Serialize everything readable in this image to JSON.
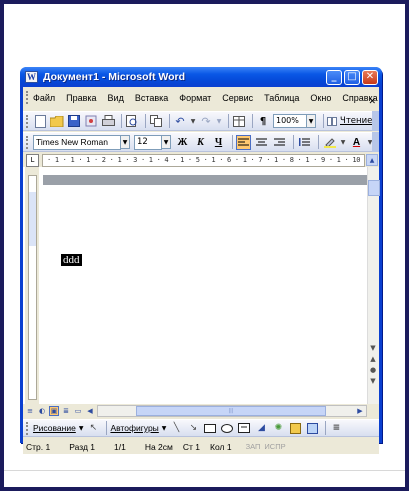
{
  "window": {
    "title": "Документ1 - Microsoft Word",
    "icon_label": "W",
    "minimize_glyph": "_",
    "maximize_glyph": "□",
    "close_glyph": "✕"
  },
  "menubar": {
    "items": [
      "Файл",
      "Правка",
      "Вид",
      "Вставка",
      "Формат",
      "Сервис",
      "Таблица",
      "Окно",
      "Справка"
    ],
    "close_glyph": "✕"
  },
  "standard_toolbar": {
    "zoom": "100%",
    "read_label": "Чтение"
  },
  "formatting_toolbar": {
    "font_name": "Times New Roman",
    "font_size": "12",
    "bold": "Ж",
    "italic": "К",
    "underline": "Ч"
  },
  "ruler": {
    "marks": "· 1 · 1 · 1 · 2 · 1 · 3 · 1 · 4 · 1 · 5 · 1 · 6 · 1 · 7 · 1 · 8 · 1 · 9 · 1 · 10 ·"
  },
  "document": {
    "selected_text": "ddd"
  },
  "drawing_toolbar": {
    "draw_label": "Рисование",
    "autoshapes_label": "Автофигуры"
  },
  "statusbar": {
    "page": "Стр. 1",
    "section": "Разд 1",
    "page_of": "1/1",
    "at": "На 2см",
    "line": "Ст 1",
    "col": "Кол 1",
    "rec": "ЗАП",
    "trk": "ИСПР"
  }
}
